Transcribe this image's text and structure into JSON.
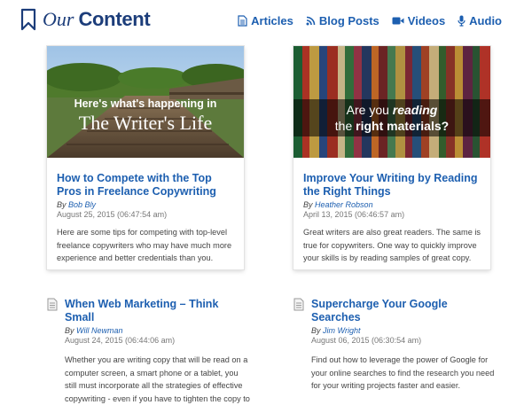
{
  "brand": {
    "our": "Our",
    "content": "Content"
  },
  "nav": [
    {
      "label": "Articles",
      "icon": "document-icon"
    },
    {
      "label": "Blog Posts",
      "icon": "rss-icon"
    },
    {
      "label": "Videos",
      "icon": "video-camera-icon"
    },
    {
      "label": "Audio",
      "icon": "microphone-icon"
    }
  ],
  "cards": [
    {
      "image_text": {
        "line1": "Here's what's happening in",
        "line2": "The Writer's Life"
      },
      "title": "How to Compete with the Top Pros in Freelance Copywriting",
      "by": "By",
      "author": "Bob Bly",
      "date": "August 25, 2015 (06:47:54 am)",
      "excerpt": "Here are some tips for competing with top-level freelance copywriters who may have much more experience and better credentials than you."
    },
    {
      "image_text": {
        "line1_pre": "Are you ",
        "line1_em": "reading",
        "line2_pre": "the ",
        "line2_bold": "right materials?"
      },
      "title": "Improve Your Writing by Reading the Right Things",
      "by": "By",
      "author": "Heather Robson",
      "date": "April 13, 2015 (06:46:57 am)",
      "excerpt": "Great writers are also great readers. The same is true for copywriters. One way to quickly improve your skills is by reading samples of great copy."
    }
  ],
  "entries": [
    {
      "icon": "document-icon",
      "title": "When Web Marketing – Think Small",
      "by": "By",
      "author": "Will Newman",
      "date": "August 24, 2015 (06:44:06 am)",
      "excerpt": "Whether you are writing copy that will be read on a computer screen, a smart phone or a tablet, you still must incorporate all the strategies of effective copywriting - even if you have to tighten the copy to"
    },
    {
      "icon": "document-icon",
      "title": "Supercharge Your Google Searches",
      "by": "By",
      "author": "Jim Wright",
      "date": "August 06, 2015 (06:30:54 am)",
      "excerpt": "Find out how to leverage the power of Google for your online searches to find the research you need for your writing projects faster and easier."
    }
  ],
  "colors": {
    "brand": "#1c3d7a",
    "link": "#1d5fb0"
  }
}
